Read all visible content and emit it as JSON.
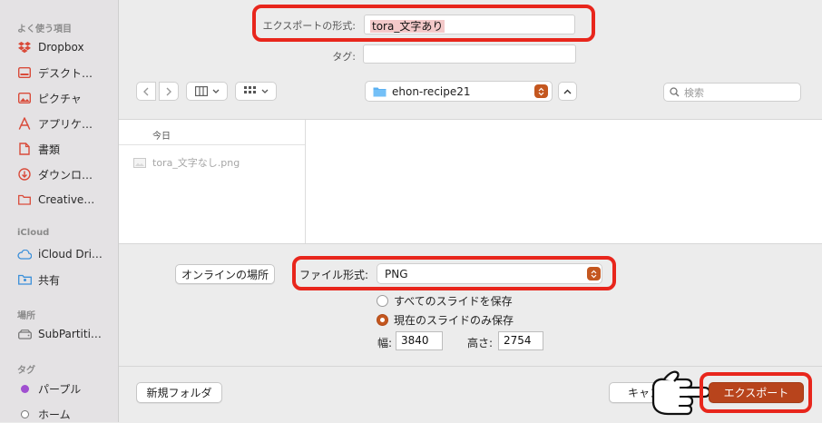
{
  "sidebar": {
    "favorites_heading": "よく使う項目",
    "favorites": [
      {
        "label": "Dropbox",
        "icon": "dropbox-icon"
      },
      {
        "label": "デスクト…",
        "icon": "desktop-icon"
      },
      {
        "label": "ピクチャ",
        "icon": "pictures-icon"
      },
      {
        "label": "アプリケ…",
        "icon": "applications-icon"
      },
      {
        "label": "書類",
        "icon": "document-icon"
      },
      {
        "label": "ダウンロ…",
        "icon": "download-icon"
      },
      {
        "label": "Creative…",
        "icon": "folder-icon"
      }
    ],
    "icloud_heading": "iCloud",
    "icloud": [
      {
        "label": "iCloud Dri…",
        "icon": "cloud-icon"
      },
      {
        "label": "共有",
        "icon": "shared-folder-icon"
      }
    ],
    "places_heading": "場所",
    "places": [
      {
        "label": "SubPartiti…",
        "icon": "drive-icon"
      }
    ],
    "tags_heading": "タグ",
    "tags": [
      {
        "label": "パープル",
        "color": "#a04fd0"
      },
      {
        "label": "ホーム",
        "color": "#ffffff"
      }
    ]
  },
  "export": {
    "name_label": "エクスポートの形式:",
    "name_value": "tora_文字あり",
    "tag_label": "タグ:",
    "tag_value": ""
  },
  "toolbar": {
    "back_icon": "chevron-left-icon",
    "forward_icon": "chevron-right-icon",
    "view_icon": "columns-icon",
    "group_icon": "grid-icon",
    "folder_name": "ehon-recipe21",
    "search_placeholder": "検索"
  },
  "browser": {
    "column_header": "今日",
    "files": [
      {
        "name": "tora_文字なし.png"
      }
    ]
  },
  "options": {
    "online_button": "オンラインの場所",
    "format_label": "ファイル形式:",
    "format_value": "PNG",
    "radio_all": "すべてのスライドを保存",
    "radio_current": "現在のスライドのみ保存",
    "radio_selected": "current",
    "width_label": "幅:",
    "width_value": "3840",
    "height_label": "高さ:",
    "height_value": "2754"
  },
  "footer": {
    "new_folder": "新規フォルダ",
    "cancel": "キャン",
    "export": "エクスポート"
  },
  "colors": {
    "accent": "#c4571f",
    "highlight": "#e8261c"
  }
}
